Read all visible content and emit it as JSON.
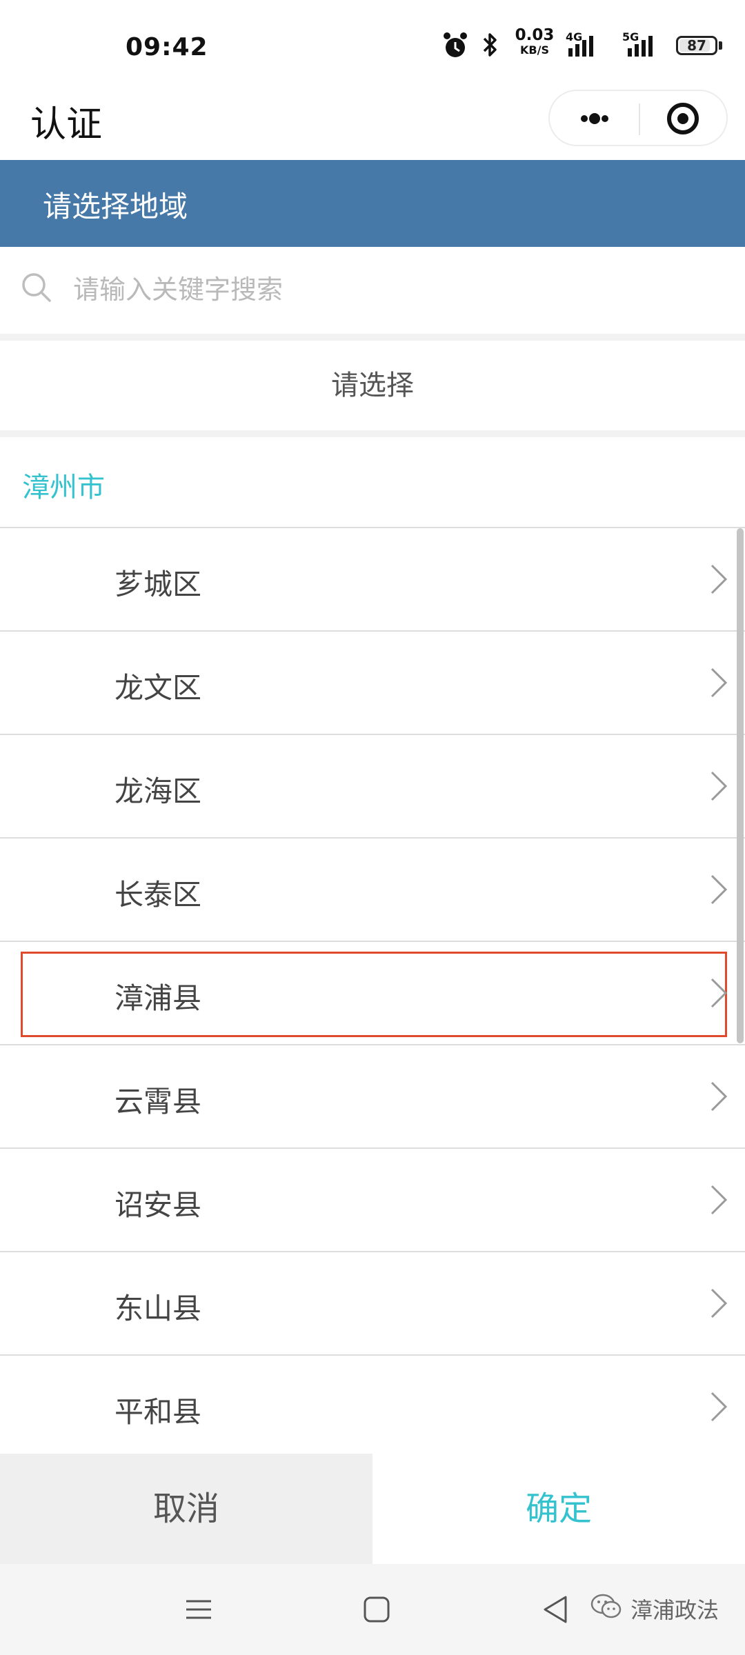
{
  "status_bar": {
    "time": "09:42",
    "net_speed_value": "0.03",
    "net_speed_unit": "KB/S",
    "signal_1": "4G",
    "signal_2": "5G",
    "battery": "87",
    "icons": [
      "alarm-icon",
      "bluetooth-icon",
      "signal-4g-icon",
      "signal-5g-icon",
      "battery-icon"
    ]
  },
  "titlebar": {
    "title": "认证",
    "capsule_icons": [
      "more-icon",
      "close-icon"
    ]
  },
  "panel": {
    "header": "请选择地域",
    "search_placeholder": "请输入关键字搜索",
    "prompt": "请选择",
    "breadcrumb": "漳州市"
  },
  "regions": [
    {
      "label": "芗城区"
    },
    {
      "label": "龙文区"
    },
    {
      "label": "龙海区"
    },
    {
      "label": "长泰区"
    },
    {
      "label": "漳浦县",
      "highlighted": true
    },
    {
      "label": "云霄县"
    },
    {
      "label": "诏安县"
    },
    {
      "label": "东山县"
    },
    {
      "label": "平和县"
    }
  ],
  "buttons": {
    "cancel": "取消",
    "confirm": "确定"
  },
  "navbar": {
    "icons": [
      "menu-icon",
      "home-icon",
      "back-icon"
    ],
    "watermark": "漳浦政法"
  },
  "colors": {
    "header_bg": "#4779a8",
    "accent": "#35c2cf",
    "highlight_border": "#e04a2c"
  }
}
